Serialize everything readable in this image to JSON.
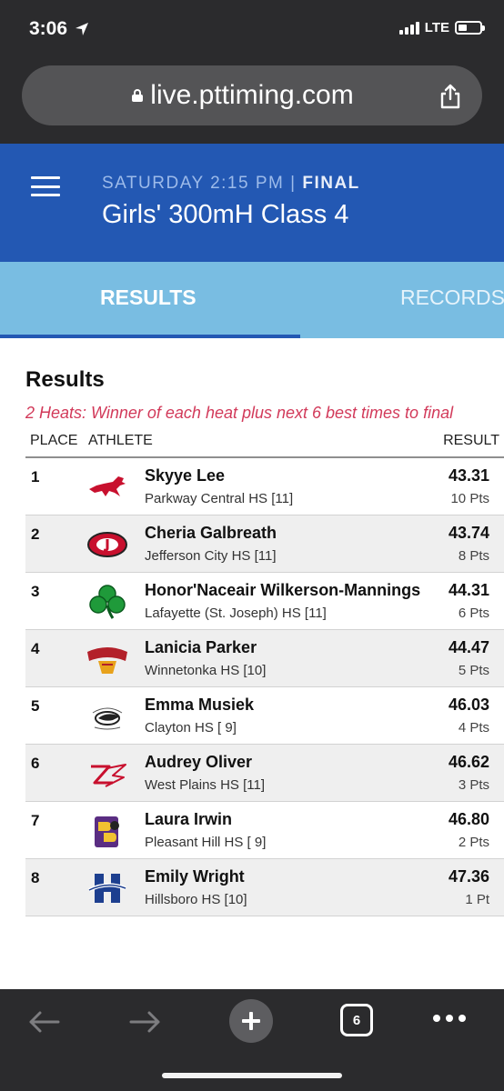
{
  "status_bar": {
    "time": "3:06",
    "network": "LTE"
  },
  "browser": {
    "url": "live.pttiming.com",
    "tab_count": "6"
  },
  "event": {
    "day_time": "SATURDAY 2:15 PM",
    "separator": "|",
    "round": "FINAL",
    "title": "Girls' 300mH Class 4"
  },
  "tabs": {
    "results": "RESULTS",
    "records": "RECORDS"
  },
  "results": {
    "title": "Results",
    "note": "2 Heats: Winner of each heat plus next 6 best times to final",
    "headers": {
      "place": "PLACE",
      "athlete": "ATHLETE",
      "result": "RESULT"
    },
    "rows": [
      {
        "place": "1",
        "name": "Skyye Lee",
        "school": "Parkway Central HS [11]",
        "mark": "43.31",
        "points": "10 Pts",
        "logo": "mustang-logo"
      },
      {
        "place": "2",
        "name": "Cheria Galbreath",
        "school": "Jefferson City HS [11]",
        "mark": "43.74",
        "points": "8 Pts",
        "logo": "jays-logo"
      },
      {
        "place": "3",
        "name": "Honor'Naceair Wilkerson-Mannings",
        "school": "Lafayette (St. Joseph) HS [11]",
        "mark": "44.31",
        "points": "6 Pts",
        "logo": "shamrock-logo"
      },
      {
        "place": "4",
        "name": "Lanicia Parker",
        "school": "Winnetonka HS [10]",
        "mark": "44.47",
        "points": "5 Pts",
        "logo": "griffins-logo"
      },
      {
        "place": "5",
        "name": "Emma Musiek",
        "school": "Clayton HS [ 9]",
        "mark": "46.03",
        "points": "4 Pts",
        "logo": "greyhounds-logo"
      },
      {
        "place": "6",
        "name": "Audrey Oliver",
        "school": "West Plains HS [11]",
        "mark": "46.62",
        "points": "3 Pts",
        "logo": "zizzers-logo"
      },
      {
        "place": "7",
        "name": "Laura Irwin",
        "school": "Pleasant Hill HS [ 9]",
        "mark": "46.80",
        "points": "2 Pts",
        "logo": "roosters-logo"
      },
      {
        "place": "8",
        "name": "Emily Wright",
        "school": "Hillsboro HS [10]",
        "mark": "47.36",
        "points": "1 Pt",
        "logo": "hawks-logo"
      }
    ]
  },
  "colors": {
    "header_blue": "#2358b3",
    "tab_blue": "#79bde2",
    "note_red": "#d23a5a",
    "chrome_dark": "#2b2b2d"
  }
}
